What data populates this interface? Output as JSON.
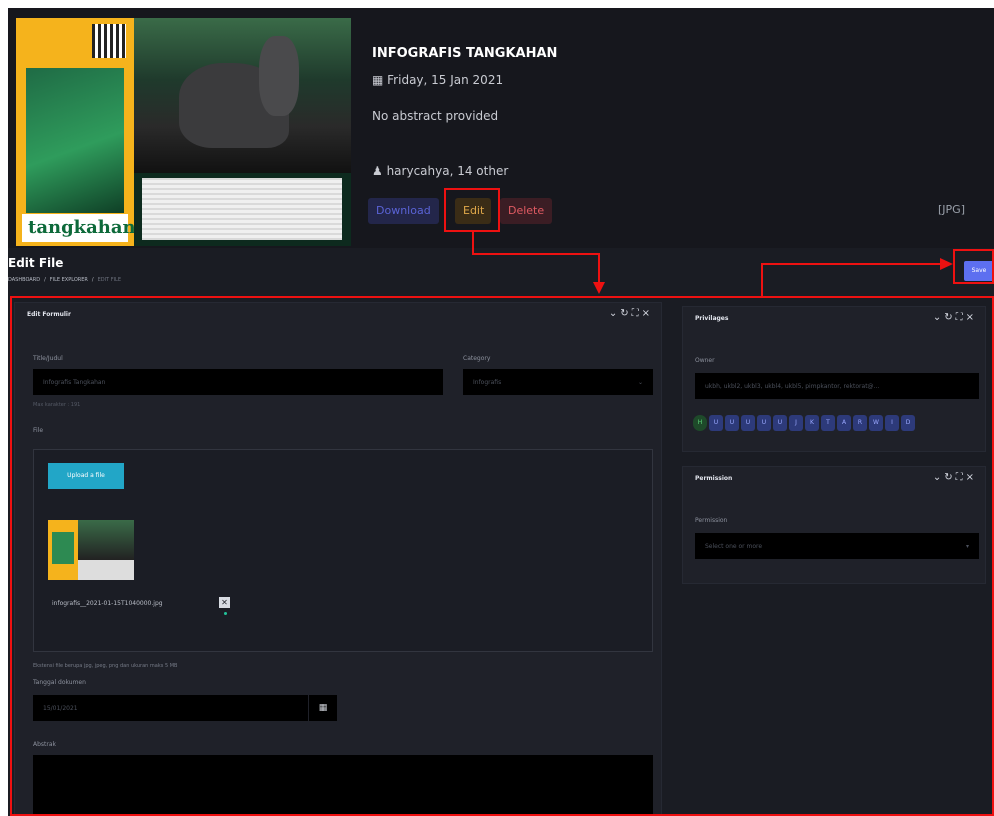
{
  "hero": {
    "poster_logo_text": "tangkahan",
    "title": "INFOGRAFIS TANGKAHAN",
    "date": "Friday, 15 Jan 2021",
    "abstract": "No abstract provided",
    "author": "harycahya, 14 other",
    "download_label": "Download",
    "edit_label": "Edit",
    "delete_label": "Delete",
    "file_ext": "[JPG]",
    "calendar_icon": "calendar-icon",
    "user_icon": "user-icon"
  },
  "page": {
    "title": "Edit File",
    "breadcrumb": [
      "DASHBOARD",
      "FILE EXPLORER",
      "EDIT FILE"
    ],
    "save_label": "Save"
  },
  "form_panel": {
    "title": "Edit Formulir",
    "tools": [
      "collapse-icon",
      "refresh-icon",
      "expand-icon",
      "close-icon"
    ],
    "title_label": "Title/Judul",
    "title_value": "Infografis Tangkahan",
    "title_help": "Max karakter : 191",
    "category_label": "Category",
    "category_value": "Infografis",
    "file_label": "File",
    "upload_label": "Upload a file",
    "file_name": "infografis__2021-01-15T1040000.jpg",
    "file_help": "Ekstensi file berupa jpg, jpeg, png dan ukuran maks 5 MB",
    "date_label": "Tanggal dokumen",
    "date_value": "15/01/2021",
    "abstract_label": "Abstrak"
  },
  "privileges_panel": {
    "title": "Privilages",
    "owner_label": "Owner",
    "owner_value": "ukbh, ukbl2, ukbl3, ukbl4, ukbl5, pimpkantor, rektorat@...",
    "tags": [
      "H",
      "U",
      "U",
      "U",
      "U",
      "U",
      "J",
      "K",
      "T",
      "A",
      "R",
      "W",
      "I",
      "D"
    ]
  },
  "permission_panel": {
    "title": "Permission",
    "permission_label": "Permission",
    "permission_value": "Select one or more"
  },
  "colors": {
    "background": "#1a1c23",
    "panel": "#1f2129",
    "save_button": "#5d6ff0",
    "upload_button": "#22a6c7",
    "annotation": "#ee1111"
  }
}
